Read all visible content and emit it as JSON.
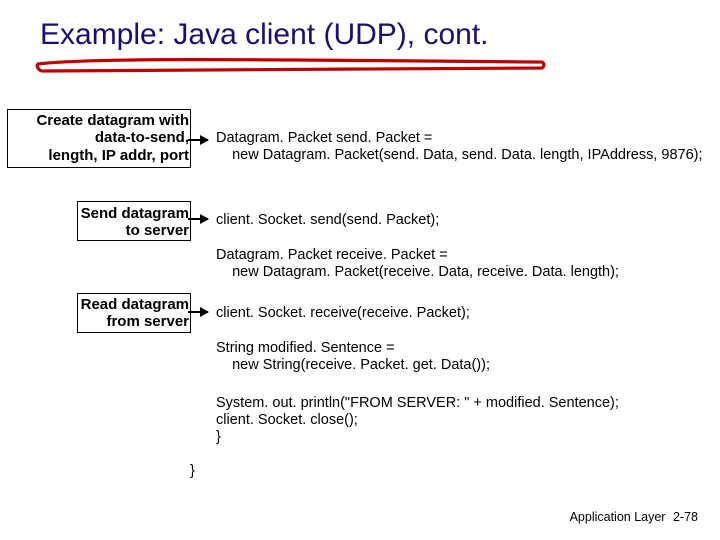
{
  "title": "Example: Java client (UDP), cont.",
  "annotations": {
    "a1_l1": "Create datagram with",
    "a1_l2": "data-to-send,",
    "a1_l3": "length, IP addr, port",
    "a2_l1": "Send datagram",
    "a2_l2": "to server",
    "a3_l1": "Read datagram",
    "a3_l2": "from server"
  },
  "code": {
    "l1": "Datagram. Packet send. Packet =",
    "l2": "    new Datagram. Packet(send. Data, send. Data. length, IPAddress, 9876);",
    "l3": "client. Socket. send(send. Packet);",
    "l4": "Datagram. Packet receive. Packet =",
    "l5": "    new Datagram. Packet(receive. Data, receive. Data. length);",
    "l6": "client. Socket. receive(receive. Packet);",
    "l7": "String modified. Sentence =",
    "l8": "    new String(receive. Packet. get. Data());",
    "l9": "System. out. println(\"FROM SERVER: \" + modified. Sentence);",
    "l10": "client. Socket. close();",
    "l11": "}",
    "l12": "}"
  },
  "footer": {
    "label": "Application Layer",
    "page": "2-78"
  },
  "colors": {
    "title": "#1D0C73",
    "underline": "#C00000"
  }
}
